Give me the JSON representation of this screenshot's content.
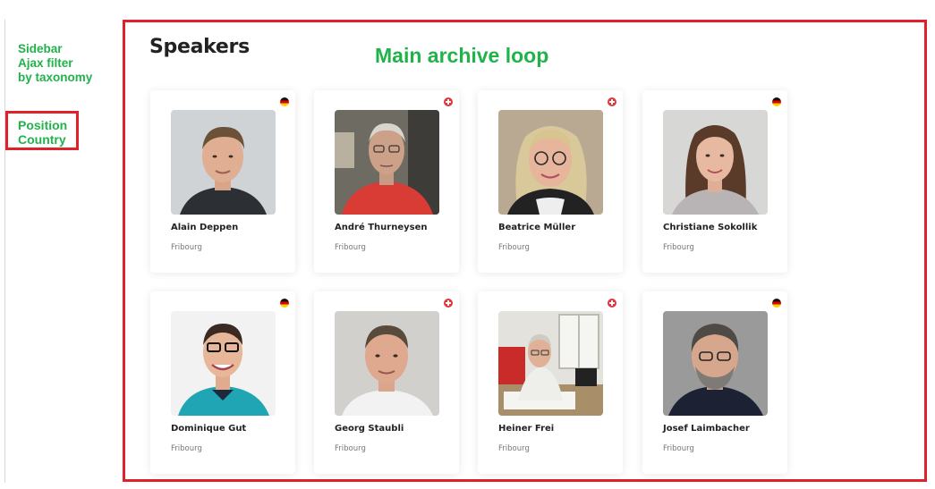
{
  "sidebar": {
    "note_lines": [
      "Sidebar",
      "Ajax filter",
      "by taxonomy"
    ],
    "filter_items": [
      "Position",
      "Country"
    ]
  },
  "main": {
    "title": "Speakers",
    "annotation": "Main archive loop"
  },
  "speakers": [
    {
      "name": "Alain Deppen",
      "city": "Fribourg",
      "flag": "de-flag-icon"
    },
    {
      "name": "André Thurneysen",
      "city": "Fribourg",
      "flag": "ch-flag-icon"
    },
    {
      "name": "Beatrice Müller",
      "city": "Fribourg",
      "flag": "ch-flag-icon"
    },
    {
      "name": "Christiane Sokollik",
      "city": "Fribourg",
      "flag": "de-flag-icon"
    },
    {
      "name": "Dominique Gut",
      "city": "Fribourg",
      "flag": "de-flag-icon"
    },
    {
      "name": "Georg Staubli",
      "city": "Fribourg",
      "flag": "ch-flag-icon"
    },
    {
      "name": "Heiner Frei",
      "city": "Fribourg",
      "flag": "ch-flag-icon"
    },
    {
      "name": "Josef Laimbacher",
      "city": "Fribourg",
      "flag": "de-flag-icon"
    }
  ],
  "colors": {
    "annotation_green": "#22b24c",
    "annotation_red": "#e0202a",
    "swiss_red": "#e2363d"
  }
}
